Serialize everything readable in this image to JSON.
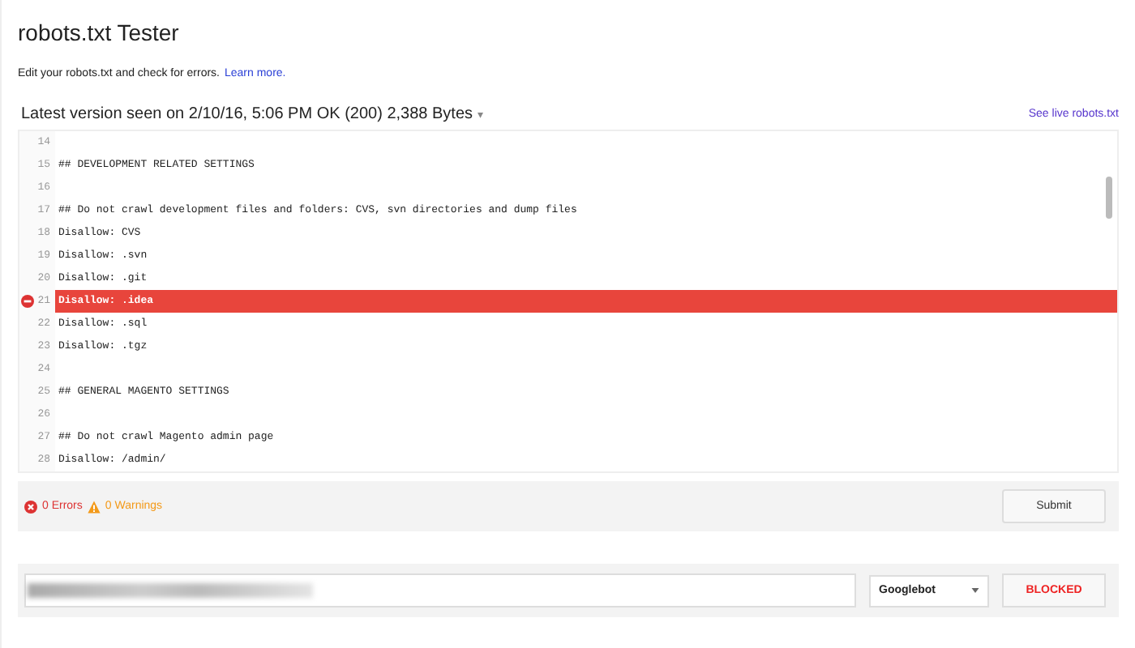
{
  "title": "robots.txt Tester",
  "intro": {
    "text": "Edit your robots.txt and check for errors.",
    "link": "Learn more."
  },
  "version": {
    "label": "Latest version seen on 2/10/16, 5:06 PM OK (200) 2,388 Bytes",
    "caret": "▾",
    "live_link": "See live robots.txt"
  },
  "editor": {
    "lines": [
      {
        "number": "14",
        "error": false
      },
      {
        "number": "15",
        "text": "## DEVELOPMENT RELATED SETTINGS",
        "error": false
      },
      {
        "number": "16",
        "error": false
      },
      {
        "number": "17",
        "text": "## Do not crawl development files and folders: CVS, svn directories and dump files",
        "error": false
      },
      {
        "number": "18",
        "text": "Disallow: CVS",
        "error": false
      },
      {
        "number": "19",
        "text": "Disallow: .svn",
        "error": false
      },
      {
        "number": "20",
        "text": "Disallow: .git",
        "error": false
      },
      {
        "number": "21",
        "text": "Disallow: .idea",
        "error": true
      },
      {
        "number": "22",
        "text": "Disallow: .sql",
        "error": false
      },
      {
        "number": "23",
        "text": "Disallow: .tgz",
        "error": false
      },
      {
        "number": "24",
        "error": false
      },
      {
        "number": "25",
        "text": "## GENERAL MAGENTO SETTINGS",
        "error": false
      },
      {
        "number": "26",
        "error": false
      },
      {
        "number": "27",
        "text": "## Do not crawl Magento admin page",
        "error": false
      },
      {
        "number": "28",
        "text": "Disallow: /admin/",
        "error": false
      }
    ]
  },
  "status": {
    "errors": "0 Errors",
    "warnings": "0 Warnings",
    "submit": "Submit"
  },
  "test": {
    "agent": "Googlebot",
    "result": "BLOCKED"
  }
}
